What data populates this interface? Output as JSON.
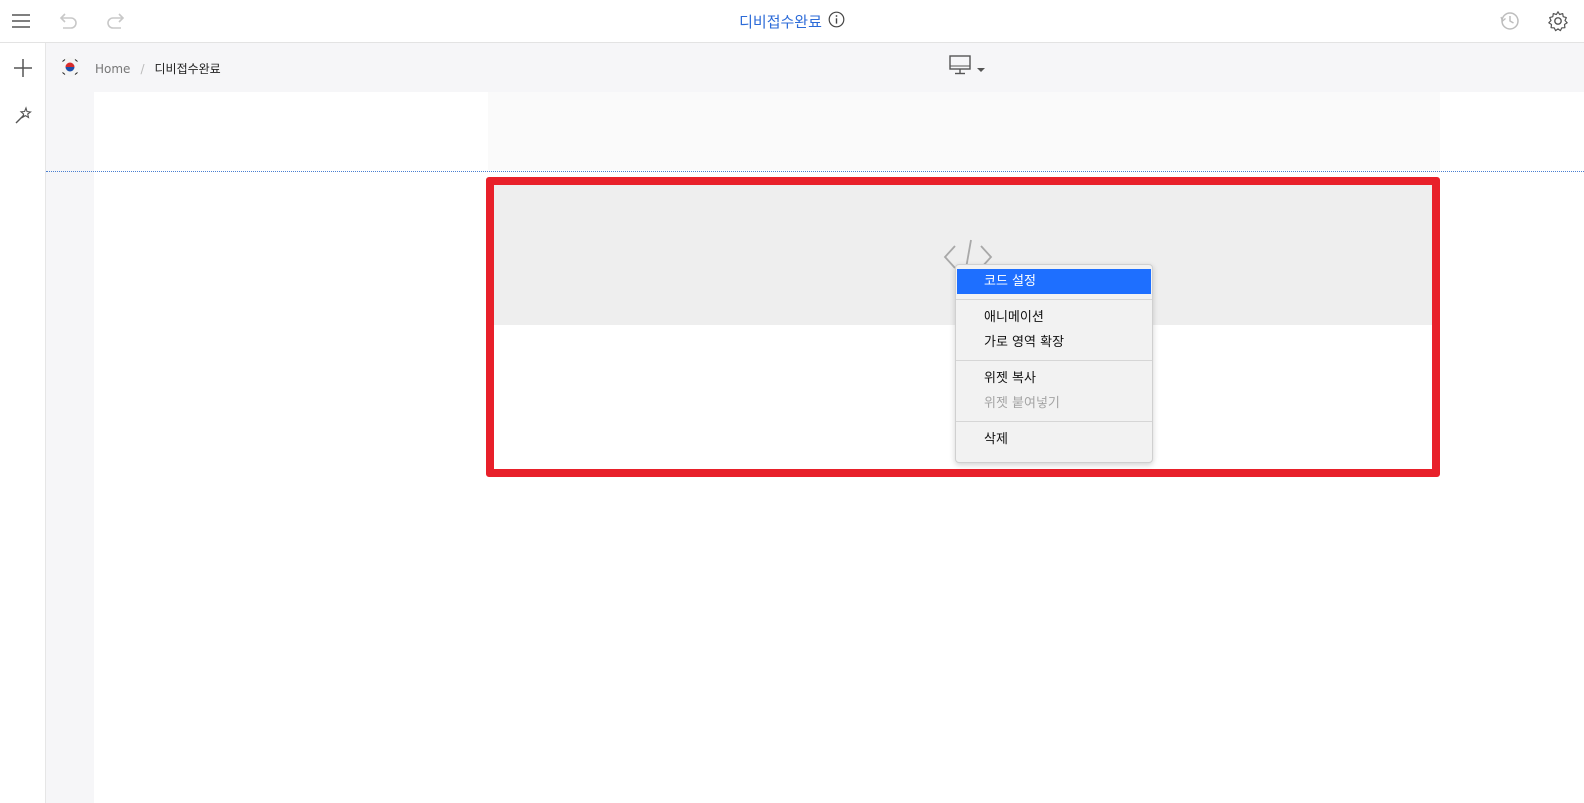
{
  "toolbar": {
    "menu_icon": "hamburger-icon",
    "undo_icon": "undo-icon",
    "redo_icon": "redo-icon",
    "title": "디비접수완료",
    "info_icon": "info-icon",
    "history_icon": "history-icon",
    "settings_icon": "gear-icon"
  },
  "sidebar": {
    "items": [
      {
        "icon": "plus-icon"
      },
      {
        "icon": "magic-wand-icon"
      }
    ]
  },
  "breadcrumb": {
    "language_flag": "korea-flag-icon",
    "home": "Home",
    "separator": "/",
    "current": "디비접수완료"
  },
  "device_selector": {
    "icon": "desktop-monitor-icon",
    "caret": "caret-down-icon"
  },
  "widget": {
    "icon": "code-icon",
    "highlight_color": "#e8202a"
  },
  "context_menu": {
    "groups": [
      {
        "items": [
          {
            "label": "코드 설정",
            "state": "active"
          }
        ]
      },
      {
        "items": [
          {
            "label": "애니메이션",
            "state": "normal"
          },
          {
            "label": "가로 영역 확장",
            "state": "normal"
          }
        ]
      },
      {
        "items": [
          {
            "label": "위젯 복사",
            "state": "normal"
          },
          {
            "label": "위젯 붙여넣기",
            "state": "disabled"
          }
        ]
      },
      {
        "items": [
          {
            "label": "삭제",
            "state": "normal"
          }
        ]
      }
    ]
  },
  "colors": {
    "accent": "#2c6bd8",
    "menu_active": "#1e6fff",
    "selection_border": "#e8202a"
  }
}
